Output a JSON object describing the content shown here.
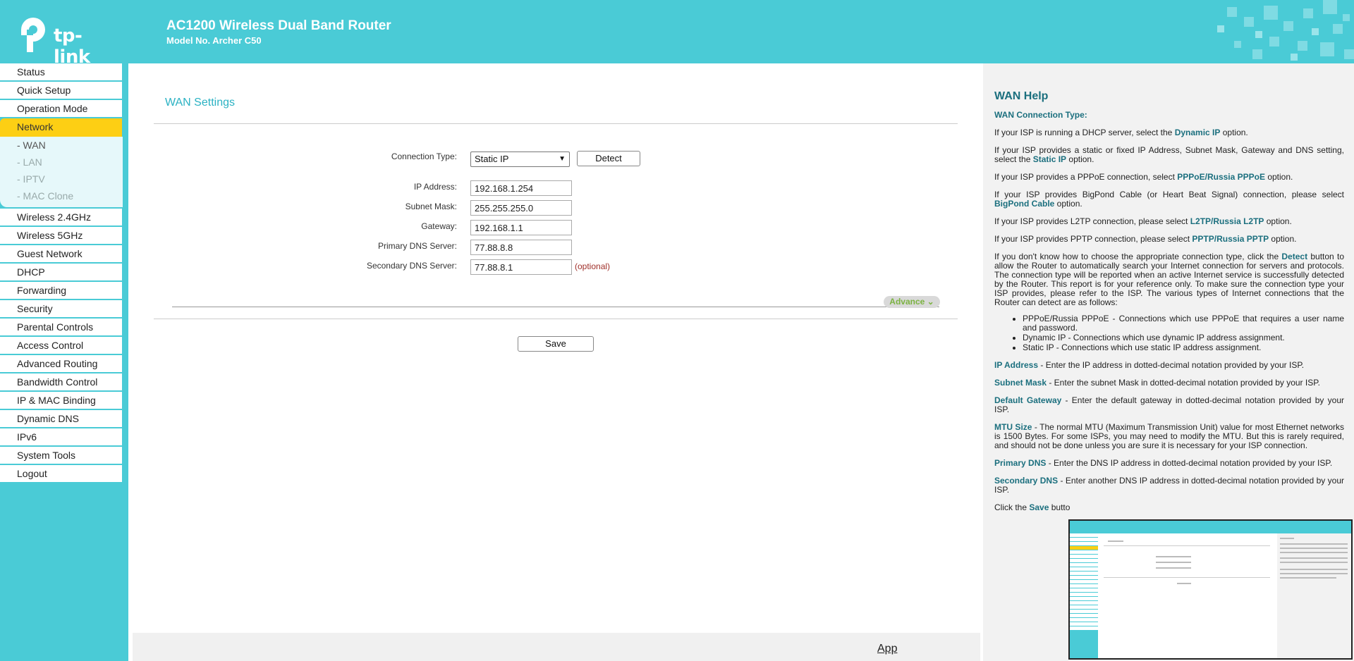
{
  "header": {
    "brand": "tp-link",
    "title": "AC1200 Wireless Dual Band Router",
    "model": "Model No. Archer C50"
  },
  "sidebar": {
    "items_before": [
      {
        "label": "Status"
      },
      {
        "label": "Quick Setup"
      },
      {
        "label": "Operation Mode"
      }
    ],
    "active": {
      "label": "Network"
    },
    "sub_items": [
      {
        "label": "- WAN"
      },
      {
        "label": "- LAN"
      },
      {
        "label": "- IPTV"
      },
      {
        "label": "- MAC Clone"
      }
    ],
    "items_after": [
      {
        "label": "Wireless 2.4GHz"
      },
      {
        "label": "Wireless 5GHz"
      },
      {
        "label": "Guest Network"
      },
      {
        "label": "DHCP"
      },
      {
        "label": "Forwarding"
      },
      {
        "label": "Security"
      },
      {
        "label": "Parental Controls"
      },
      {
        "label": "Access Control"
      },
      {
        "label": "Advanced Routing"
      },
      {
        "label": "Bandwidth Control"
      },
      {
        "label": "IP & MAC Binding"
      },
      {
        "label": "Dynamic DNS"
      },
      {
        "label": "IPv6"
      },
      {
        "label": "System Tools"
      },
      {
        "label": "Logout"
      }
    ]
  },
  "main": {
    "title": "WAN Settings",
    "connection_type_label": "Connection Type:",
    "connection_type_value": "Static IP",
    "detect_label": "Detect",
    "fields": [
      {
        "label": "IP Address:",
        "value": "192.168.1.254"
      },
      {
        "label": "Subnet Mask:",
        "value": "255.255.255.0"
      },
      {
        "label": "Gateway:",
        "value": "192.168.1.1"
      },
      {
        "label": "Primary DNS Server:",
        "value": "77.88.8.8"
      },
      {
        "label": "Secondary DNS Server:",
        "value": "77.88.8.1"
      }
    ],
    "optional_note": "(optional)",
    "advance_label": "Advance",
    "advance_arrow": "⌄",
    "save_label": "Save",
    "app_link": "App"
  },
  "help": {
    "title": "WAN Help",
    "subtitle": "WAN Connection Type:",
    "p1_pre": "If your ISP is running a DHCP server, select the ",
    "p1_b": "Dynamic IP",
    "p1_post": " option.",
    "p2_pre": "If your ISP provides a static or fixed IP Address, Subnet Mask, Gateway and DNS setting, select the ",
    "p2_b": "Static IP",
    "p2_post": " option.",
    "p3_pre": "If your ISP provides a PPPoE connection, select ",
    "p3_b": "PPPoE/Russia PPPoE",
    "p3_post": " option.",
    "p4_pre": "If your ISP provides BigPond Cable (or Heart Beat Signal) connection, please select ",
    "p4_b": "BigPond Cable",
    "p4_post": " option.",
    "p5_pre": "If your ISP provides L2TP connection, please select ",
    "p5_b": "L2TP/Russia L2TP",
    "p5_post": " option.",
    "p6_pre": "If your ISP provides PPTP connection, please select ",
    "p6_b": "PPTP/Russia PPTP",
    "p6_post": " option.",
    "p7_pre": "If you don't know how to choose the appropriate connection type, click the ",
    "p7_b": "Detect",
    "p7_post": " button to allow the Router to automatically search your Internet connection for servers and protocols. The connection type will be reported when an active Internet service is successfully detected by the Router. This report is for your reference only. To make sure the connection type your ISP provides, please refer to the ISP. The various types of Internet connections that the Router can detect are as follows:",
    "list": [
      "PPPoE/Russia PPPoE - Connections which use PPPoE that requires a user name and password.",
      "Dynamic IP - Connections which use dynamic IP address assignment.",
      "Static IP - Connections which use static IP address assignment."
    ],
    "ip_b": "IP Address",
    "ip_text": " - Enter the IP address in dotted-decimal notation provided by your ISP.",
    "mask_b": "Subnet Mask",
    "mask_text": " - Enter the subnet Mask in dotted-decimal notation provided by your ISP.",
    "gw_b": "Default Gateway",
    "gw_text": " - Enter the default gateway in dotted-decimal notation provided by your ISP.",
    "mtu_b": "MTU Size",
    "mtu_text": " - The normal MTU (Maximum Transmission Unit) value for most Ethernet networks is 1500 Bytes. For some ISPs, you may need to modify the MTU. But this is rarely required, and should not be done unless you are sure it is necessary for your ISP connection.",
    "pdns_b": "Primary DNS",
    "pdns_text": " - Enter the DNS IP address in dotted-decimal notation provided by your ISP.",
    "sdns_b": "Secondary DNS",
    "sdns_text": " - Enter another DNS IP address in dotted-decimal notation provided by your ISP.",
    "last_pre": "Click the ",
    "last_b": "Save",
    "last_post": " butto"
  },
  "colors": {
    "brand_teal": "#4acbd6",
    "active_yellow": "#fdcf14",
    "help_accent": "#1b6f7e"
  }
}
